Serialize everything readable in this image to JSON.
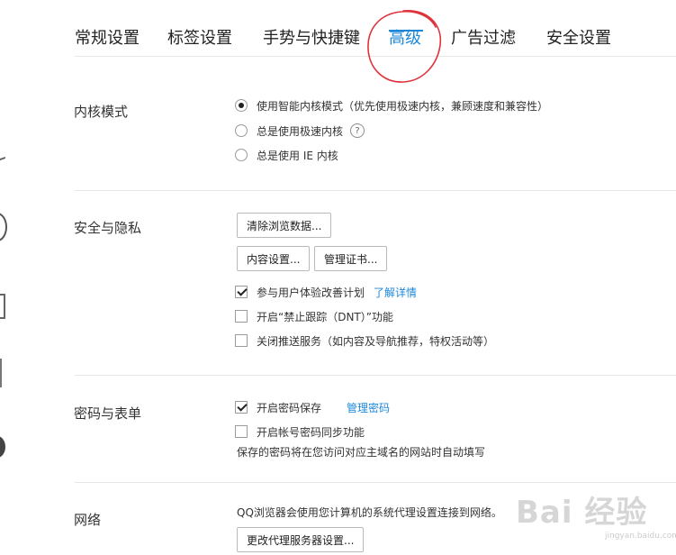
{
  "tabs": [
    {
      "label": "常规设置"
    },
    {
      "label": "标签设置"
    },
    {
      "label": "手势与快捷键"
    },
    {
      "label": "高级",
      "active": true
    },
    {
      "label": "广告过滤"
    },
    {
      "label": "安全设置"
    }
  ],
  "kernel": {
    "title": "内核模式",
    "options": [
      {
        "label": "使用智能内核模式（优先使用极速内核，兼顾速度和兼容性）",
        "checked": true
      },
      {
        "label": "总是使用极速内核",
        "checked": false,
        "help_icon": "?"
      },
      {
        "label": "总是使用 IE 内核",
        "checked": false
      }
    ]
  },
  "privacy": {
    "title": "安全与隐私",
    "clear_button": "清除浏览数据...",
    "content_button": "内容设置...",
    "cert_button": "管理证书...",
    "options": [
      {
        "label": "参与用户体验改善计划",
        "checked": true,
        "link": "了解详情"
      },
      {
        "label": "开启“禁止跟踪（DNT）”功能",
        "checked": false
      },
      {
        "label": "关闭推送服务（如内容及导航推荐，特权活动等）",
        "checked": false
      }
    ]
  },
  "password": {
    "title": "密码与表单",
    "options": [
      {
        "label": "开启密码保存",
        "checked": true,
        "link": "管理密码"
      },
      {
        "label": "开启帐号密码同步功能",
        "checked": false
      }
    ],
    "note": "保存的密码将在您访问对应主域名的网站时自动填写"
  },
  "network": {
    "title": "网络",
    "note": "QQ浏览器会使用您计算机的系统代理设置连接到网络。",
    "proxy_button": "更改代理服务器设置..."
  },
  "watermark": {
    "main": "Bai 经验",
    "sub": "jingyan.baidu.com"
  },
  "colors": {
    "accent": "#1e88d8",
    "annotation": "#e0323a"
  }
}
